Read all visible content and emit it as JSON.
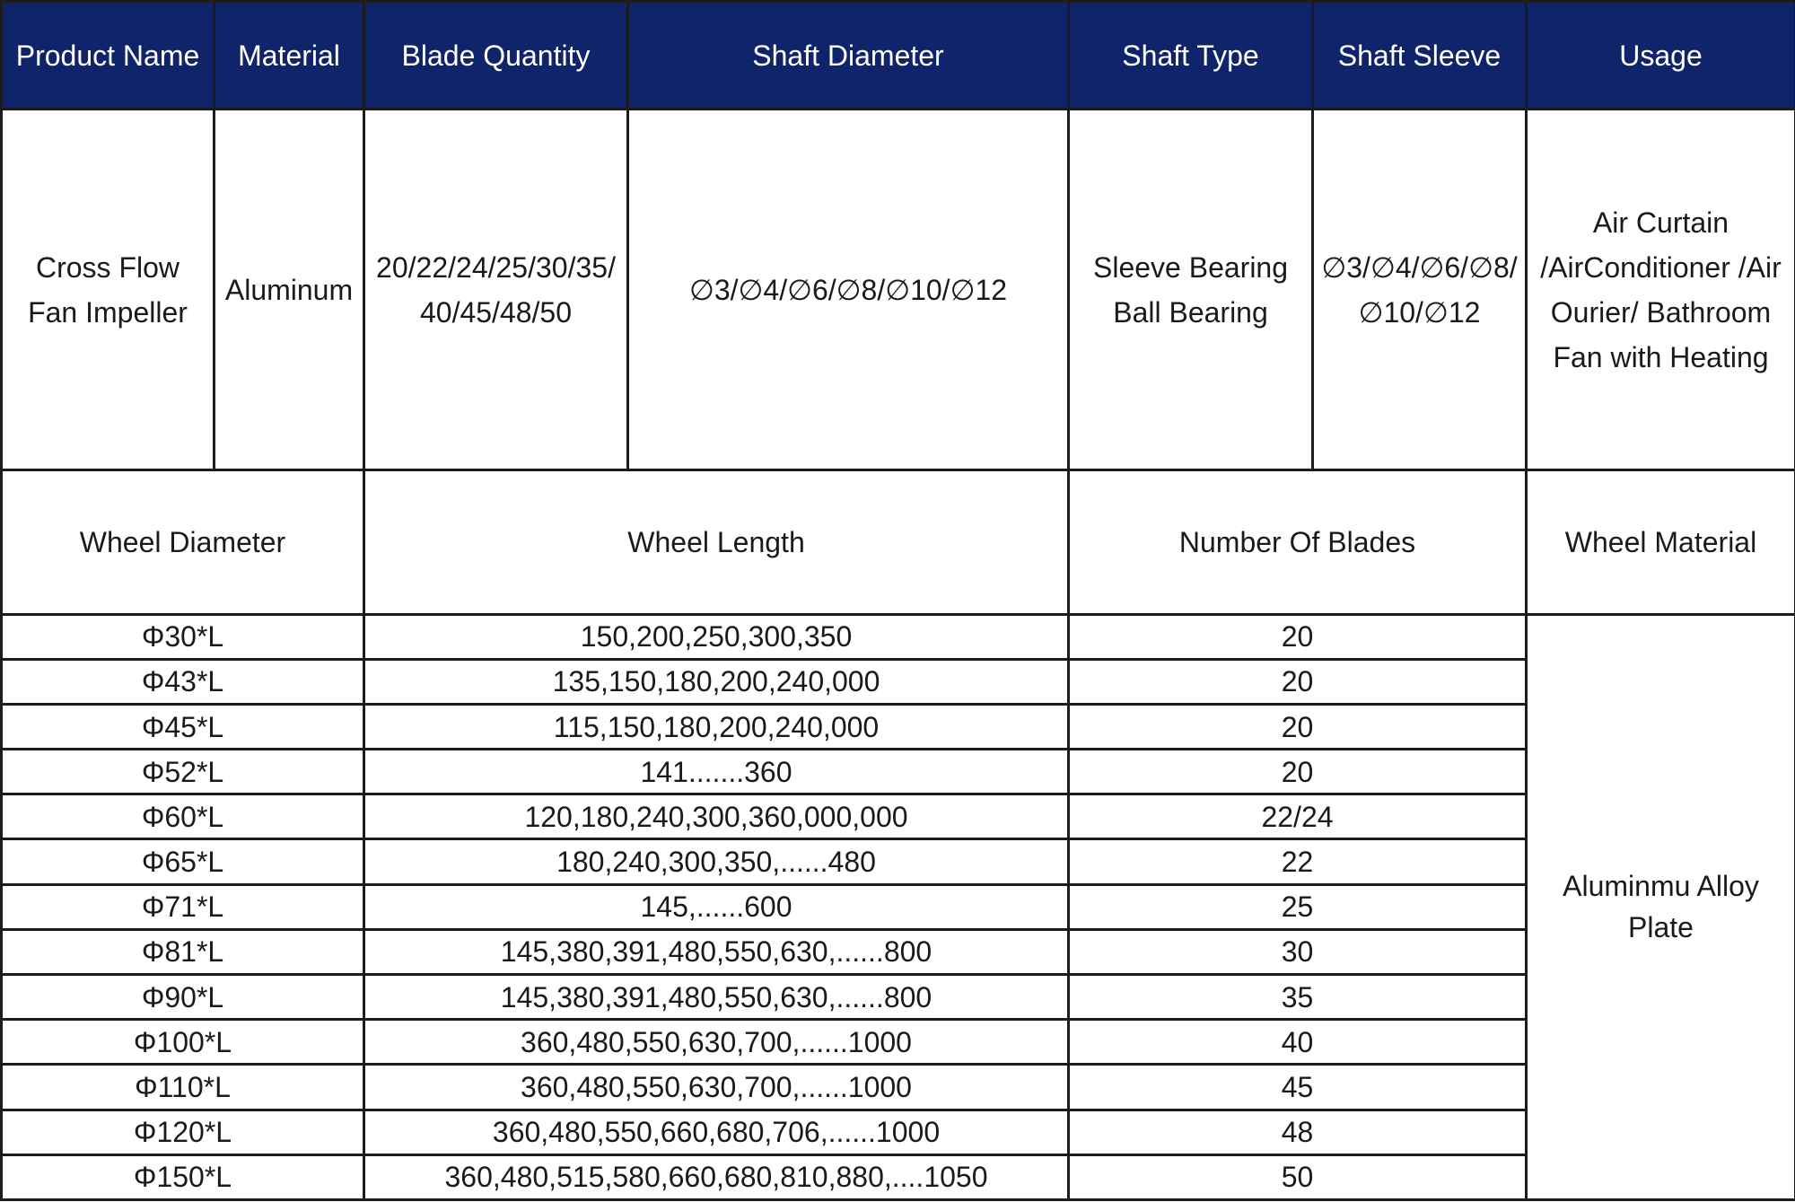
{
  "header": {
    "product_name": "Product Name",
    "material": "Material",
    "blade_quantity": "Blade Quantity",
    "shaft_diameter": "Shaft Diameter",
    "shaft_type": "Shaft Type",
    "shaft_sleeve": "Shaft Sleeve",
    "usage": "Usage"
  },
  "product": {
    "name_lines": [
      "Cross Flow",
      "Fan Impeller"
    ],
    "material": "Aluminum",
    "blade_quantity_lines": [
      "20/22/24/25/30/35/",
      "40/45/48/50"
    ],
    "shaft_diameter": "∅3/∅4/∅6/∅8/∅10/∅12",
    "shaft_type_lines": [
      "Sleeve Bearing",
      "Ball Bearing"
    ],
    "shaft_sleeve_lines": [
      "∅3/∅4/∅6/∅8/",
      "∅10/∅12"
    ],
    "usage_lines": [
      "Air Curtain",
      "/AirConditioner /Air",
      "Ourier/  Bathroom",
      "Fan with Heating"
    ]
  },
  "spec_header": {
    "wheel_diameter": "Wheel Diameter",
    "wheel_length": "Wheel Length",
    "number_of_blades": "Number Of Blades",
    "wheel_material": "Wheel Material"
  },
  "wheel_material_lines": [
    "Aluminmu Alloy",
    "Plate"
  ],
  "rows": [
    {
      "diameter": "Φ30*L",
      "length": "150,200,250,300,350",
      "blades": "20"
    },
    {
      "diameter": "Φ43*L",
      "length": "135,150,180,200,240,000",
      "blades": "20"
    },
    {
      "diameter": "Φ45*L",
      "length": "115,150,180,200,240,000",
      "blades": "20"
    },
    {
      "diameter": "Φ52*L",
      "length": "141.......360",
      "blades": "20"
    },
    {
      "diameter": "Φ60*L",
      "length": "120,180,240,300,360,000,000",
      "blades": "22/24"
    },
    {
      "diameter": "Φ65*L",
      "length": "180,240,300,350,......480",
      "blades": "22"
    },
    {
      "diameter": "Φ71*L",
      "length": "145,......600",
      "blades": "25"
    },
    {
      "diameter": "Φ81*L",
      "length": "145,380,391,480,550,630,......800",
      "blades": "30"
    },
    {
      "diameter": "Φ90*L",
      "length": "145,380,391,480,550,630,......800",
      "blades": "35"
    },
    {
      "diameter": "Φ100*L",
      "length": "360,480,550,630,700,......1000",
      "blades": "40"
    },
    {
      "diameter": "Φ110*L",
      "length": "360,480,550,630,700,......1000",
      "blades": "45"
    },
    {
      "diameter": "Φ120*L",
      "length": "360,480,550,660,680,706,......1000",
      "blades": "48"
    },
    {
      "diameter": "Φ150*L",
      "length": "360,480,515,580,660,680,810,880,....1050",
      "blades": "50"
    }
  ],
  "colors": {
    "header_background": "#10246b",
    "header_text": "#ffffff",
    "border": "#1c1c1c"
  }
}
